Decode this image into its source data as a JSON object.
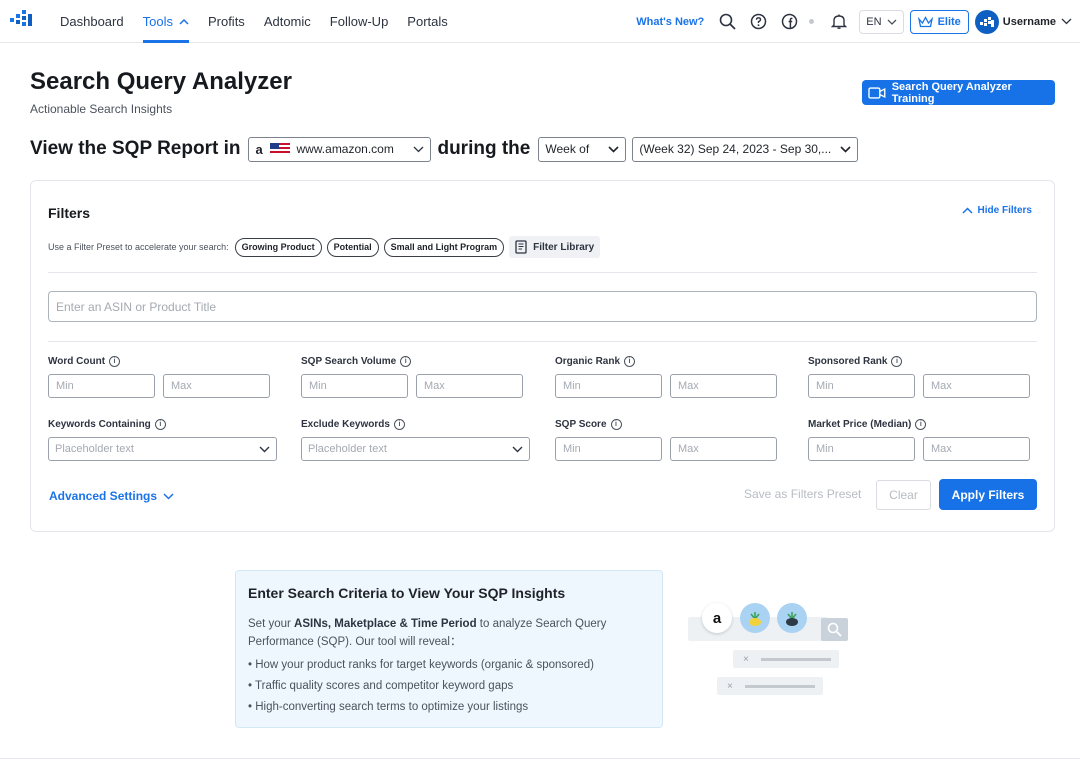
{
  "nav": {
    "items": [
      {
        "label": "Dashboard"
      },
      {
        "label": "Tools"
      },
      {
        "label": "Profits"
      },
      {
        "label": "Adtomic"
      },
      {
        "label": "Follow-Up"
      },
      {
        "label": "Portals"
      }
    ],
    "active_index": 1,
    "whats_new": "What's New?",
    "language": "EN",
    "plan": "Elite",
    "username": "Username"
  },
  "header": {
    "title": "Search Query Analyzer",
    "subtitle": "Actionable Search Insights",
    "training_button": "Search Query Analyzer Training"
  },
  "report": {
    "prefix": "View the SQP Report in",
    "marketplace_logo": "a",
    "marketplace": "www.amazon.com",
    "during": "during the",
    "period_type": "Week of",
    "period_range": "(Week 32) Sep 24, 2023 - Sep 30,..."
  },
  "filters": {
    "title": "Filters",
    "hide_label": "Hide Filters",
    "preset_label": "Use a Filter Preset to accelerate your search:",
    "presets": [
      {
        "label": "Growing Product"
      },
      {
        "label": "Potential"
      },
      {
        "label": "Small and Light Program"
      }
    ],
    "library_label": "Filter Library",
    "asin_placeholder": "Enter an ASIN or Product Title",
    "fields_row1": [
      {
        "label": "Word Count",
        "min": "Min",
        "max": "Max"
      },
      {
        "label": "SQP Search Volume",
        "min": "Min",
        "max": "Max"
      },
      {
        "label": "Organic Rank",
        "min": "Min",
        "max": "Max"
      },
      {
        "label": "Sponsored Rank",
        "min": "Min",
        "max": "Max"
      }
    ],
    "fields_row2": {
      "keywords_containing": {
        "label": "Keywords Containing",
        "placeholder": "Placeholder text"
      },
      "exclude_keywords": {
        "label": "Exclude Keywords",
        "placeholder": "Placeholder text"
      },
      "sqp_score": {
        "label": "SQP Score",
        "min": "Min",
        "max": "Max"
      },
      "market_price": {
        "label": "Market Price (Median)",
        "min": "Min",
        "max": "Max"
      }
    },
    "advanced_settings": "Advanced Settings",
    "save_preset": "Save as Filters Preset",
    "clear": "Clear",
    "apply": "Apply Filters"
  },
  "info": {
    "title": "Enter Search Criteria to View Your SQP Insights",
    "desc_pre": "Set your ",
    "desc_bold": "ASINs, Maketplace & Time Period",
    "desc_post": " to analyze Search Query Performance (SQP). Our tool will reveal：",
    "bullets": [
      "How your product ranks for target keywords (organic & sponsored)",
      "Traffic quality scores and competitor keyword gaps",
      "High-converting search terms to optimize your listings"
    ]
  },
  "illustration": {
    "logo": "a",
    "remove_glyph": "×"
  },
  "colors": {
    "accent": "#1672e6",
    "link": "#1a73e8",
    "info_bg": "#eef7fd"
  }
}
